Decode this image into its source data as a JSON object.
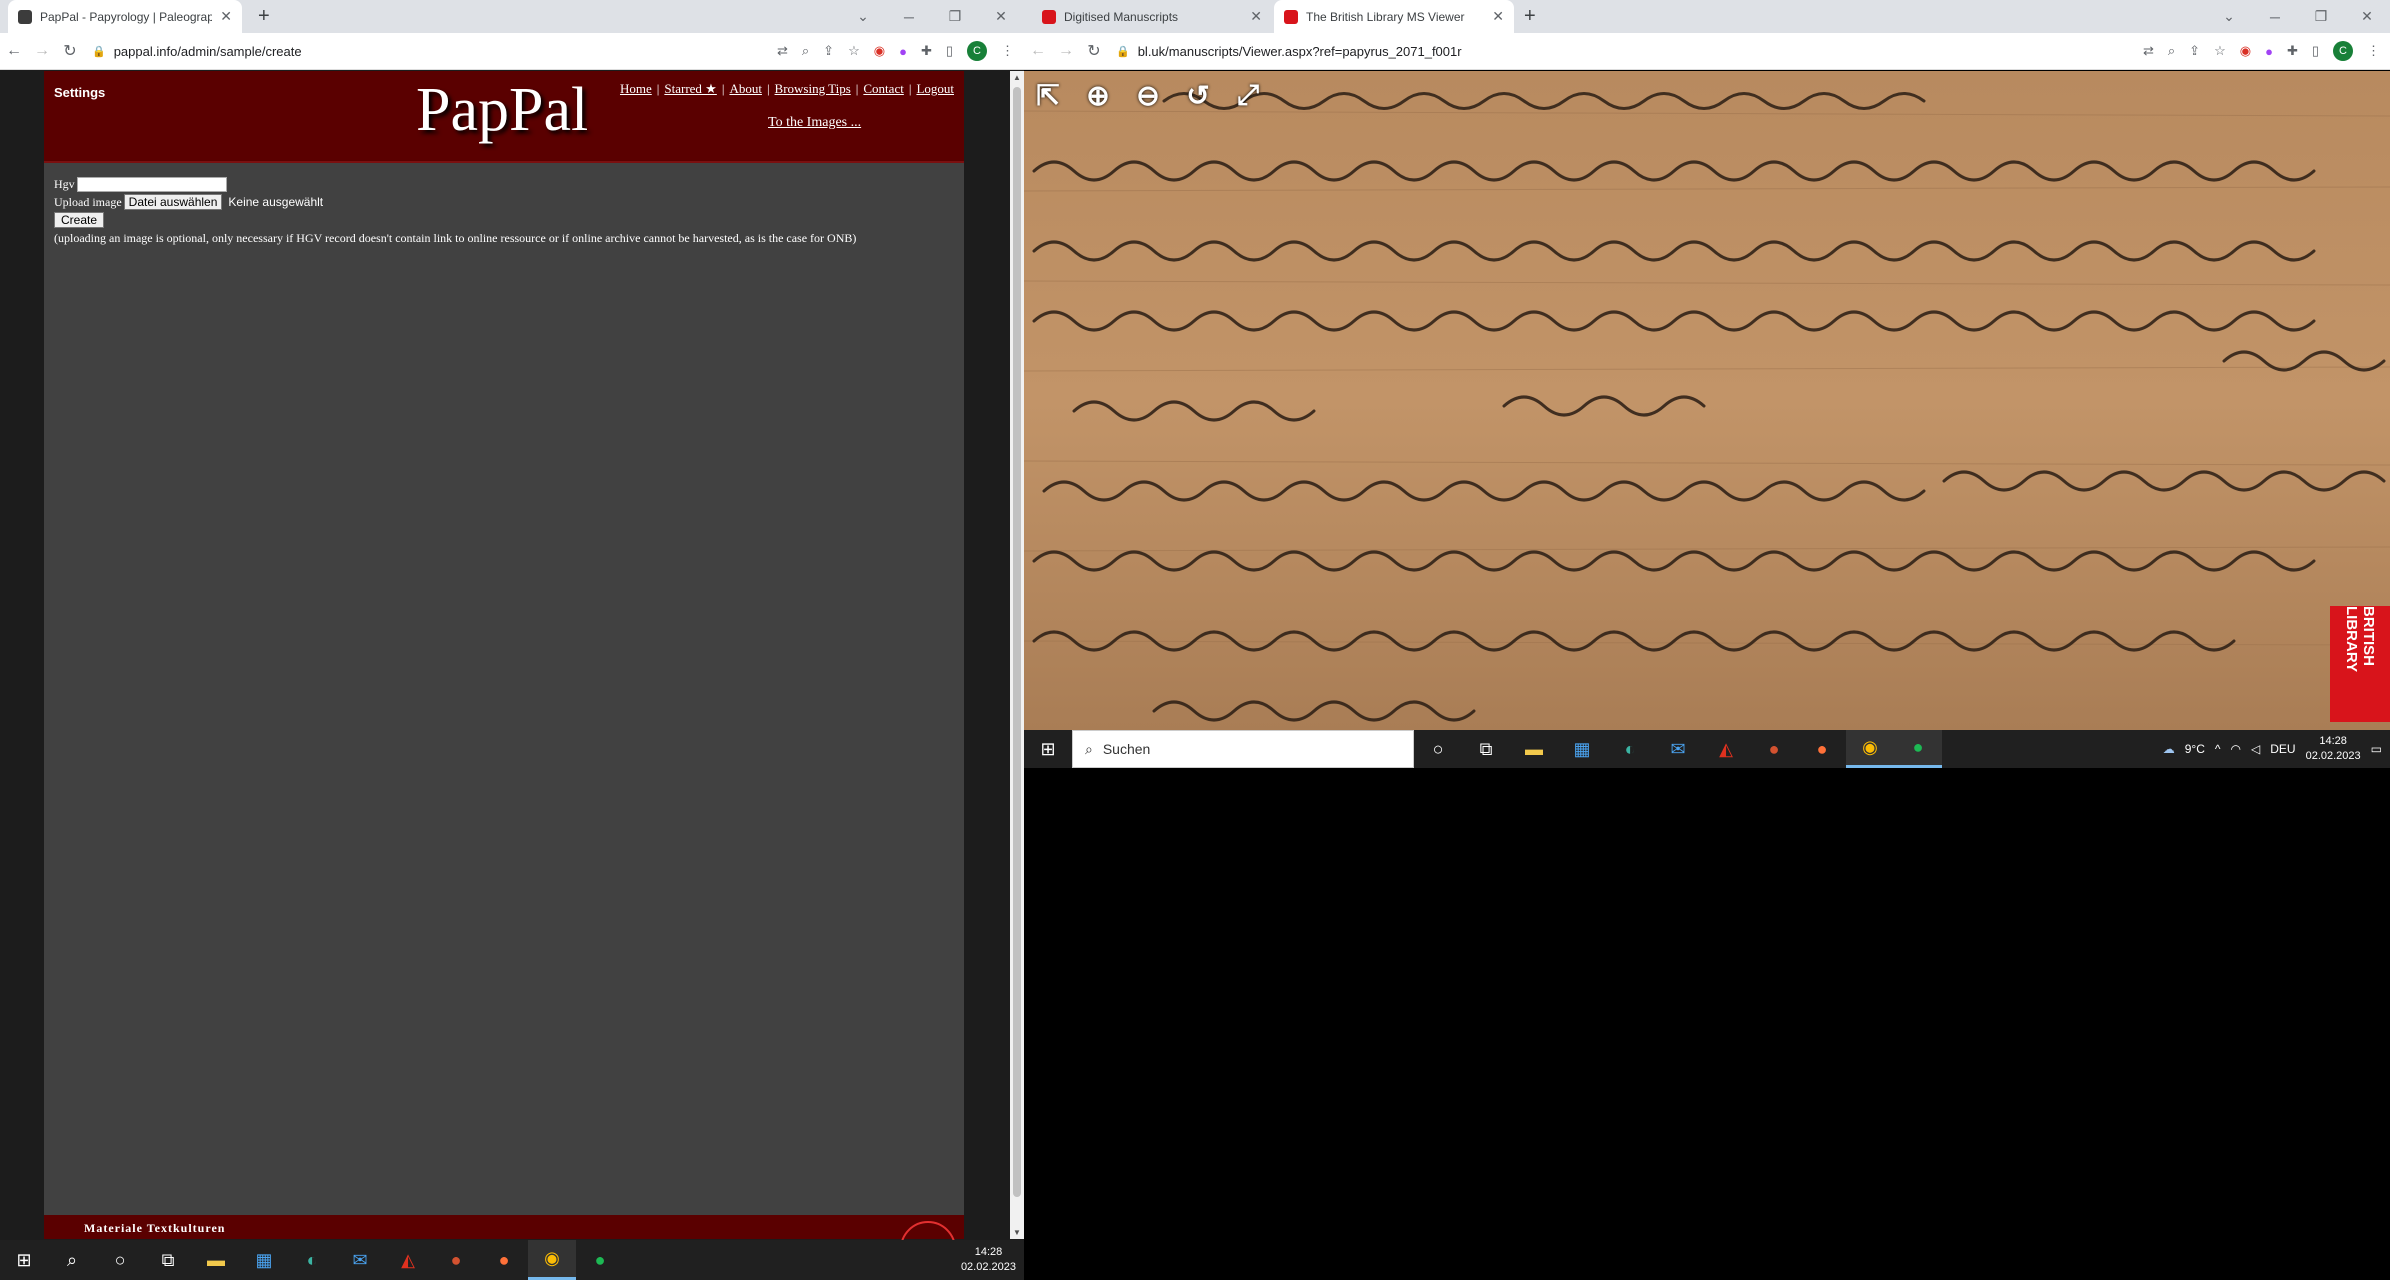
{
  "left_window": {
    "tabs": [
      {
        "title": "PapPal - Papyrology | Paleograph",
        "favicon_color": "#3c3c3c"
      }
    ],
    "url": "pappal.info/admin/sample/create",
    "page": {
      "settings": "Settings",
      "logo": "PapPal",
      "nav": [
        "Home",
        "Starred ★",
        "About",
        "Browsing Tips",
        "Contact",
        "Logout"
      ],
      "to_images": "To the Images ...",
      "form": {
        "hgv_label": "Hgv",
        "hgv_value": "",
        "upload_label": "Upload image",
        "file_button": "Datei auswählen",
        "file_status": "Keine ausgewählt",
        "create_button": "Create",
        "note": "(uploading an image is optional, only necessary if HGV record doesn't contain link to online ressource or if online archive cannot be harvested, as is the case for ONB)"
      },
      "footer": "Materiale Textkulturen"
    },
    "taskbar": {
      "time": "14:28",
      "date": "02.02.2023"
    }
  },
  "right_window": {
    "tabs": [
      {
        "title": "Digitised Manuscripts",
        "favicon_color": "#d8141b"
      },
      {
        "title": "The British Library MS Viewer",
        "favicon_color": "#d8141b"
      }
    ],
    "url": "bl.uk/manuscripts/Viewer.aspx?ref=papyrus_2071_f001r",
    "viewer": {
      "tools": [
        "back-icon",
        "zoom-in-icon",
        "zoom-out-icon",
        "rotate-icon",
        "fullscreen-icon"
      ],
      "badge": "BRITISH LIBRARY"
    },
    "taskbar": {
      "search_placeholder": "Suchen",
      "weather": "9°C",
      "language": "DEU",
      "time": "14:28",
      "date": "02.02.2023"
    }
  }
}
